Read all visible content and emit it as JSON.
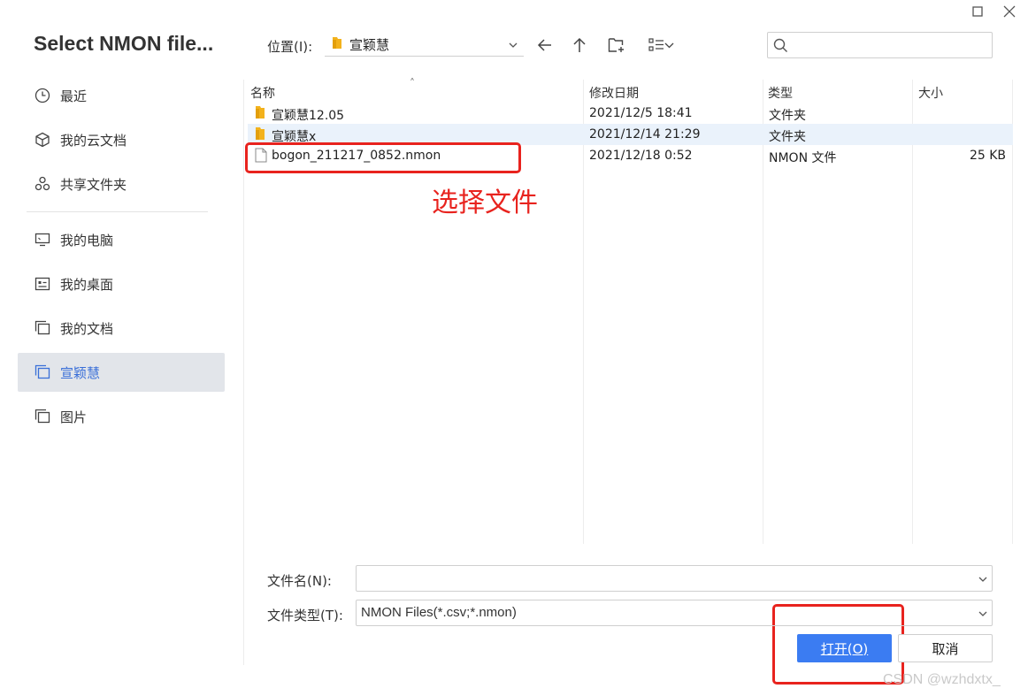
{
  "dialog": {
    "title": "Select NMON file..."
  },
  "sidebar": {
    "items": [
      {
        "label": "最近",
        "icon": "clock-icon"
      },
      {
        "label": "我的云文档",
        "icon": "cube-icon"
      },
      {
        "label": "共享文件夹",
        "icon": "share-icon"
      },
      {
        "label": "我的电脑",
        "icon": "monitor-icon"
      },
      {
        "label": "我的桌面",
        "icon": "desktop-icon"
      },
      {
        "label": "我的文档",
        "icon": "documents-icon"
      },
      {
        "label": "宣颖慧",
        "icon": "folder-stack-icon",
        "active": true
      },
      {
        "label": "图片",
        "icon": "pictures-icon"
      }
    ]
  },
  "toolbar": {
    "location_label": "位置(I):",
    "location_value": "宣颖慧",
    "search_placeholder": ""
  },
  "file_list": {
    "columns": [
      "名称",
      "修改日期",
      "类型",
      "大小"
    ],
    "rows": [
      {
        "name": "宣颖慧12.05",
        "date": "2021/12/5 18:41",
        "type": "文件夹",
        "size": "",
        "kind": "folder"
      },
      {
        "name": "宣颖慧x",
        "date": "2021/12/14 21:29",
        "type": "文件夹",
        "size": "",
        "kind": "folder"
      },
      {
        "name": "bogon_211217_0852.nmon",
        "date": "2021/12/18 0:52",
        "type": "NMON 文件",
        "size": "25 KB",
        "kind": "file"
      }
    ]
  },
  "annotation": {
    "text": "选择文件",
    "color": "#e8231e"
  },
  "footer": {
    "filename_label": "文件名(N):",
    "filename_value": "",
    "filetype_label": "文件类型(T):",
    "filetype_value": "NMON Files(*.csv;*.nmon)",
    "open_label": "打开(O)",
    "cancel_label": "取消"
  },
  "colors": {
    "accent": "#3b7cf2",
    "active_bg": "#e2e5ea",
    "hover_row": "#eaf2fb"
  },
  "watermark": "CSDN @wzhdxtx_"
}
